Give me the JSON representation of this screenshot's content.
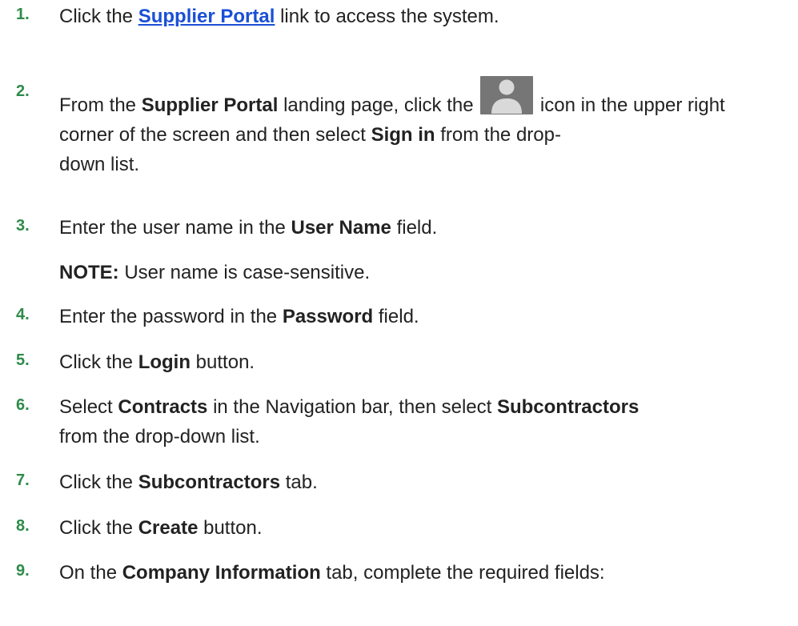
{
  "steps": [
    {
      "number": "1.",
      "parts": {
        "a": "Click the ",
        "link": "Supplier Portal",
        "b": " link to access the system."
      }
    },
    {
      "number": "2.",
      "parts": {
        "a": "From the ",
        "b1": "Supplier Portal",
        "c": " landing page, click the ",
        "d": " icon in the upper right corner of the screen and then select ",
        "b2": "Sign in",
        "e": " from the drop-",
        "f": "down list."
      },
      "icon": "user-icon"
    },
    {
      "number": "3.",
      "parts": {
        "a": "Enter the user name in the ",
        "b": "User Name",
        "c": " field."
      },
      "note": {
        "label": "NOTE:",
        "text": " User name is case-sensitive."
      }
    },
    {
      "number": "4.",
      "parts": {
        "a": "Enter the password in the ",
        "b": "Password",
        "c": " field."
      }
    },
    {
      "number": "5.",
      "parts": {
        "a": "Click the ",
        "b": "Login",
        "c": " button."
      }
    },
    {
      "number": "6.",
      "parts": {
        "a": "Select ",
        "b1": "Contracts",
        "c": " in the Navigation bar, then select ",
        "b2": "Subcontractors",
        "d": "from the drop-down list."
      }
    },
    {
      "number": "7.",
      "parts": {
        "a": "Click the ",
        "b": "Subcontractors",
        "c": " tab."
      }
    },
    {
      "number": "8.",
      "parts": {
        "a": "Click the ",
        "b": "Create",
        "c": " button."
      }
    },
    {
      "number": "9.",
      "parts": {
        "a": "On the ",
        "b": "Company Information",
        "c": " tab, complete the required fields:"
      }
    }
  ],
  "colors": {
    "step_number": "#2e8b4a",
    "link": "#1a4fd6",
    "icon_bg": "#767676"
  }
}
